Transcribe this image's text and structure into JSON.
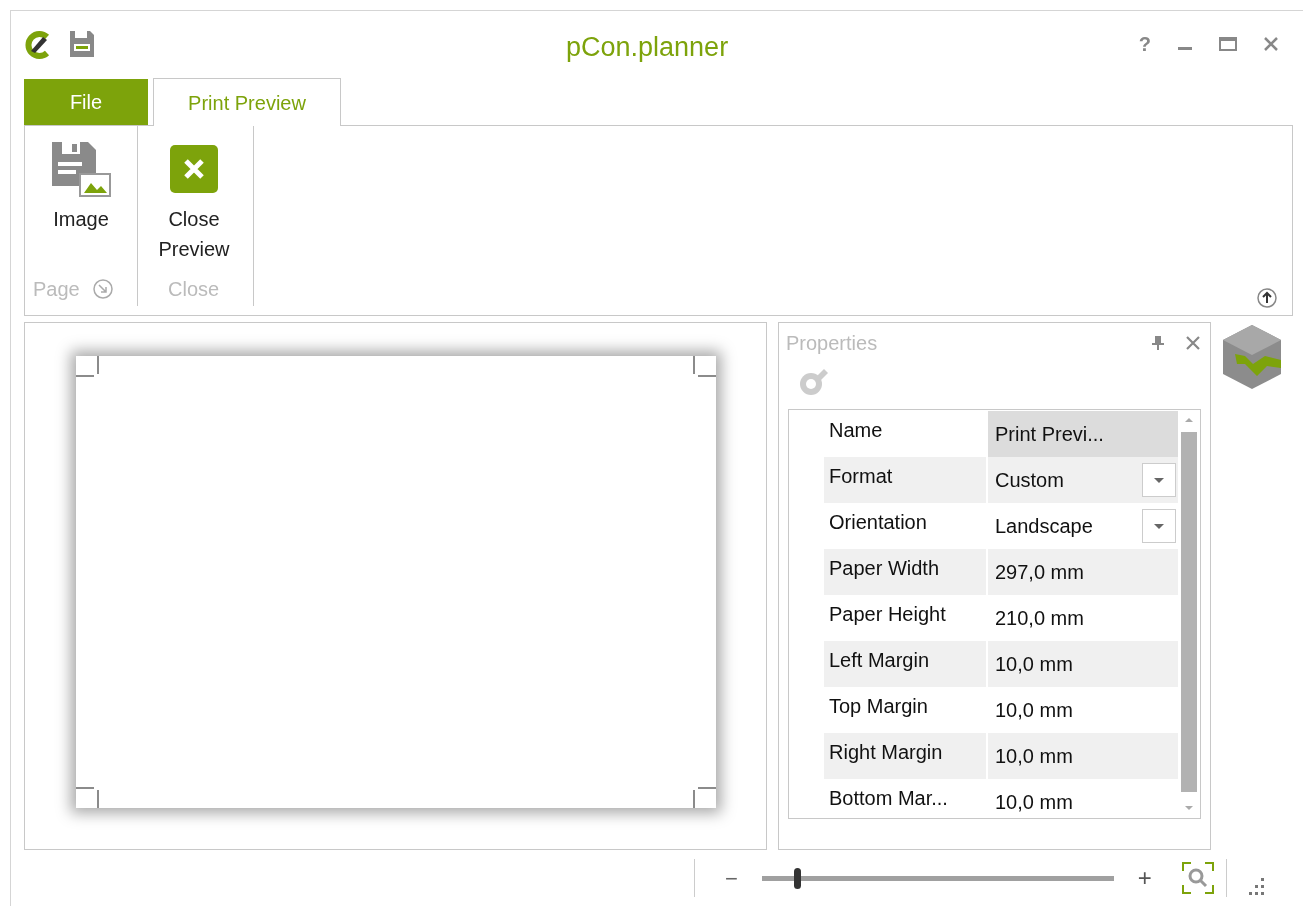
{
  "window": {
    "title": "pCon.planner",
    "help": "?"
  },
  "tabs": [
    {
      "label": "File",
      "kind": "file",
      "selected": false
    },
    {
      "label": "Print Preview",
      "kind": "tab",
      "selected": true
    }
  ],
  "ribbon": {
    "groups": [
      {
        "label": "Page",
        "launcher": true,
        "buttons": [
          {
            "label": "Image",
            "kind": "image"
          }
        ]
      },
      {
        "label": "Close",
        "launcher": false,
        "buttons": [
          {
            "label": "Close Preview",
            "kind": "close"
          }
        ]
      }
    ]
  },
  "properties": {
    "title": "Properties",
    "rows": [
      {
        "name": "Name",
        "value": "Print Previ...",
        "kind": "text",
        "selected": true
      },
      {
        "name": "Format",
        "value": "Custom",
        "kind": "dropdown",
        "selected": false
      },
      {
        "name": "Orientation",
        "value": "Landscape",
        "kind": "dropdown",
        "selected": false
      },
      {
        "name": "Paper Width",
        "value": "297,0 mm",
        "kind": "text",
        "selected": false
      },
      {
        "name": "Paper Height",
        "value": "210,0 mm",
        "kind": "text",
        "selected": false
      },
      {
        "name": "Left Margin",
        "value": "10,0 mm",
        "kind": "text",
        "selected": false
      },
      {
        "name": "Top Margin",
        "value": "10,0 mm",
        "kind": "text",
        "selected": false
      },
      {
        "name": "Right Margin",
        "value": "10,0 mm",
        "kind": "text",
        "selected": false
      },
      {
        "name": "Bottom Mar...",
        "value": "10,0 mm",
        "kind": "text",
        "selected": false
      }
    ]
  },
  "status_bar": {
    "zoom_out": "−",
    "zoom_in": "+",
    "zoom": {
      "level": 0.1
    }
  }
}
